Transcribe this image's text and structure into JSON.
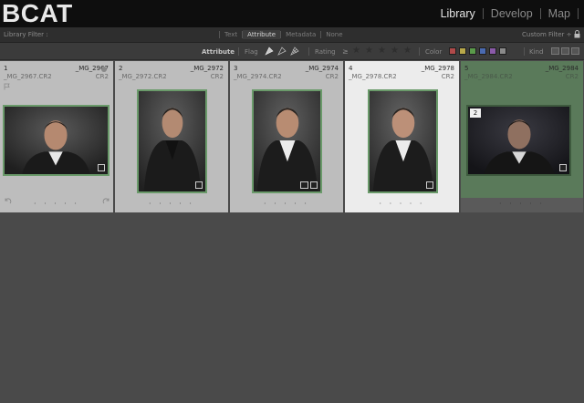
{
  "header": {
    "logo": "BCAT",
    "modules": [
      {
        "label": "Library",
        "active": true
      },
      {
        "label": "Develop",
        "active": false
      },
      {
        "label": "Map",
        "active": false
      }
    ]
  },
  "filter": {
    "label": "Library Filter :",
    "tabs": [
      {
        "label": "Text",
        "active": false
      },
      {
        "label": "Attribute",
        "active": true
      },
      {
        "label": "Metadata",
        "active": false
      },
      {
        "label": "None",
        "active": false
      }
    ],
    "custom_filter": "Custom Filter ÷"
  },
  "attribute": {
    "title": "Attribute",
    "flag_label": "Flag",
    "rating_label": "Rating",
    "rating_op": "≥",
    "color_label": "Color",
    "kind_label": "Kind",
    "colors": [
      "#b04a4a",
      "#b8a84a",
      "#5a9a4a",
      "#4a6ab0",
      "#8a5aa8",
      "#8a8a8a"
    ]
  },
  "grid": {
    "cells": [
      {
        "index": "1",
        "name": "_MG_2967",
        "file": "_MG_2967.CR2",
        "ext": "CR2",
        "dots": "· · · · ·"
      },
      {
        "index": "2",
        "name": "_MG_2972",
        "file": "_MG_2972.CR2",
        "ext": "CR2",
        "dots": "· · · · ·"
      },
      {
        "index": "3",
        "name": "_MG_2974",
        "file": "_MG_2974.CR2",
        "ext": "CR2",
        "dots": "· · · · ·"
      },
      {
        "index": "4",
        "name": "_MG_2978",
        "file": "_MG_2978.CR2",
        "ext": "CR2",
        "dots": "· · · · ·"
      },
      {
        "index": "5",
        "name": "_MG_2984",
        "file": "_MG_2984.CR2",
        "ext": "CR2",
        "dots": "· · · · ·",
        "stack_count": "2"
      }
    ]
  }
}
